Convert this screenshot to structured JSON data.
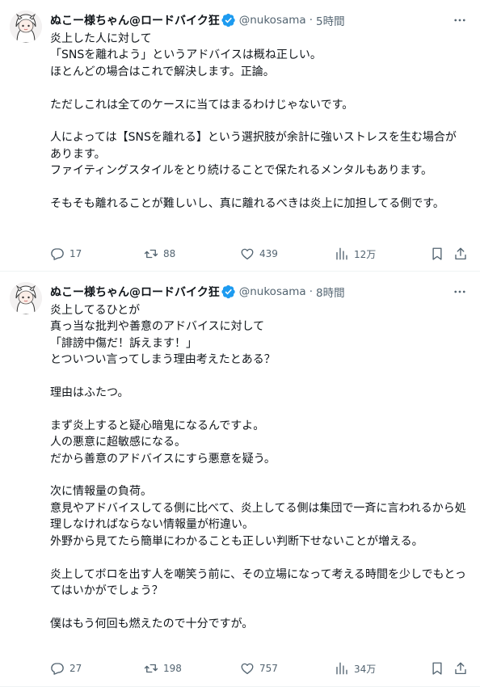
{
  "tweets": [
    {
      "author": {
        "name": "ぬこー様ちゃん@ロードバイク狂",
        "handle": "@nukosama",
        "separator": "·",
        "time": "5時間"
      },
      "text": "炎上した人に対して\n「SNSを離れよう」というアドバイスは概ね正しい。\nほとんどの場合はこれで解決します。正論。\n\nただしこれは全てのケースに当てはまるわけじゃないです。\n\n人によっては【SNSを離れる】という選択肢が余計に強いストレスを生む場合があります。\nファイティングスタイルをとり続けることで保たれるメンタルもあります。\n\nそもそも離れることが難しいし、真に離れるべきは炎上に加担してる側です。",
      "stats": {
        "replies": "17",
        "retweets": "88",
        "likes": "439",
        "views": "12万"
      }
    },
    {
      "author": {
        "name": "ぬこー様ちゃん@ロードバイク狂",
        "handle": "@nukosama",
        "separator": "·",
        "time": "8時間"
      },
      "text": "炎上してるひとが\n真っ当な批判や善意のアドバイスに対して\n「誹謗中傷だ！訴えます！」\nとついつい言ってしまう理由考えたとある？\n\n理由はふたつ。\n\nまず炎上すると疑心暗鬼になるんですよ。\n人の悪意に超敏感になる。\nだから善意のアドバイスにすら悪意を疑う。\n\n次に情報量の負荷。\n意見やアドバイスしてる側に比べて、炎上してる側は集団で一斉に言われるから処理しなければならない情報量が桁違い。\n外野から見てたら簡単にわかることも正しい判断下せないことが増える。\n\n炎上してボロを出す人を嘲笑う前に、その立場になって考える時間を少しでもとってはいかがでしょう？\n\n僕はもう何回も燃えたので十分ですが。",
      "stats": {
        "replies": "27",
        "retweets": "198",
        "likes": "757",
        "views": "34万"
      }
    }
  ],
  "icons": {
    "verified": "verified-badge-icon",
    "more": "more-icon",
    "reply": "reply-icon",
    "retweet": "retweet-icon",
    "like": "heart-icon",
    "views": "views-chart-icon",
    "bookmark": "bookmark-icon",
    "share": "share-icon"
  },
  "colors": {
    "text": "#0f1419",
    "secondary": "#536471",
    "verified": "#1d9bf0",
    "divider": "#eff3f4"
  }
}
